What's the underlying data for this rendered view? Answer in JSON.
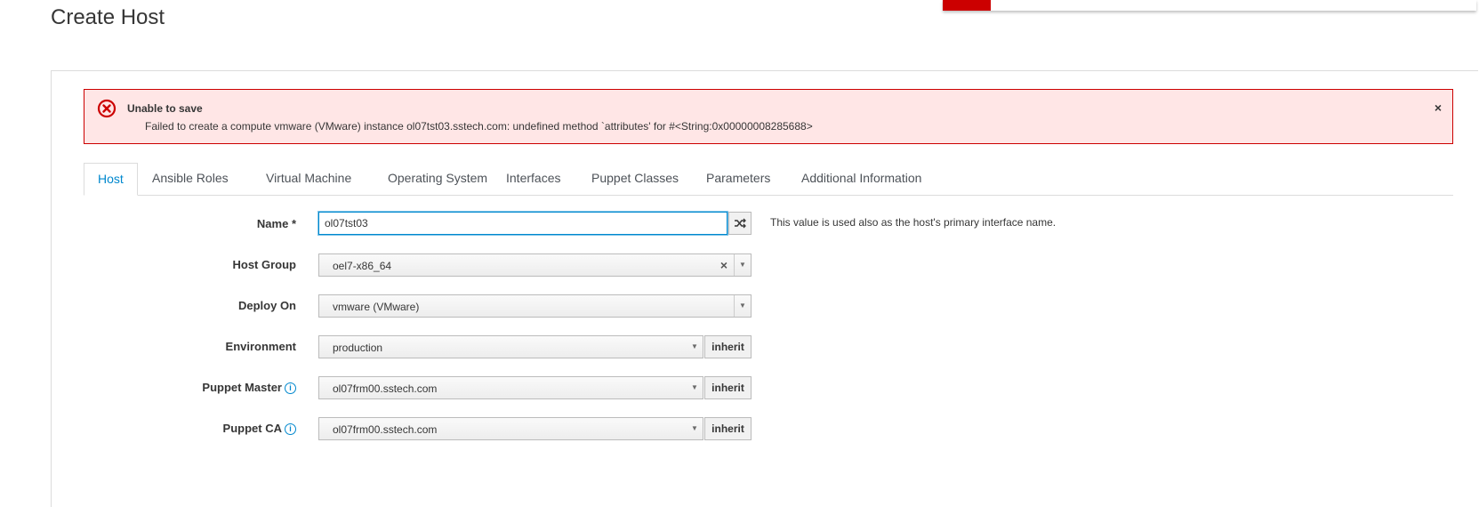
{
  "page": {
    "title": "Create Host"
  },
  "alert": {
    "title": "Unable to save",
    "message": "Failed to create a compute vmware (VMware) instance ol07tst03.sstech.com: undefined method `attributes' for #<String:0x00000008285688>",
    "close_label": "×",
    "color": "#cc0000",
    "background": "#ffe6e6"
  },
  "tabs": [
    {
      "label": "Host",
      "active": true
    },
    {
      "label": "Ansible Roles"
    },
    {
      "label": "Virtual Machine"
    },
    {
      "label": "Operating System"
    },
    {
      "label": "Interfaces"
    },
    {
      "label": "Puppet Classes"
    },
    {
      "label": "Parameters"
    },
    {
      "label": "Additional Information"
    }
  ],
  "form": {
    "name": {
      "label": "Name *",
      "value": "ol07tst03",
      "help": "This value is used also as the host's primary interface name.",
      "randomize_icon": "shuffle-icon"
    },
    "host_group": {
      "label": "Host Group",
      "value": "oel7-x86_64",
      "clear_label": "×"
    },
    "deploy_on": {
      "label": "Deploy On",
      "value": "vmware (VMware)"
    },
    "environment": {
      "label": "Environment",
      "value": "production",
      "inherit_label": "inherit"
    },
    "puppet_master": {
      "label": "Puppet Master",
      "value": "ol07frm00.sstech.com",
      "inherit_label": "inherit",
      "info_icon": "info-icon"
    },
    "puppet_ca": {
      "label": "Puppet CA",
      "value": "ol07frm00.sstech.com",
      "inherit_label": "inherit",
      "info_icon": "info-icon"
    }
  },
  "colors": {
    "accent": "#0088ce",
    "notification_accent": "#cc0000"
  }
}
